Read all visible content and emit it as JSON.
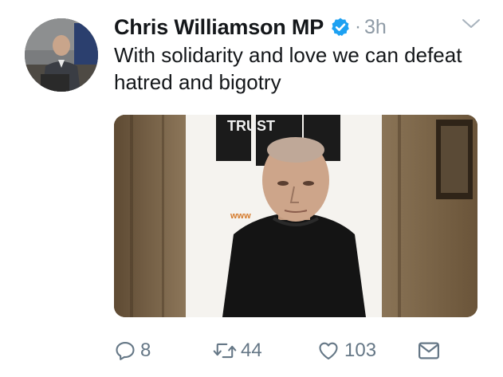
{
  "tweet": {
    "author_name": "Chris Williamson MP",
    "separator": "·",
    "time": "3h",
    "text": "With solidarity and love we can defeat hatred and bigotry",
    "verified": true
  },
  "media": {
    "banner_text": "TRUST",
    "banner_url_text": "www"
  },
  "actions": {
    "reply_count": "8",
    "retweet_count": "44",
    "like_count": "103"
  },
  "colors": {
    "text": "#14171a",
    "secondary": "#657786",
    "verified_blue": "#1da1f2"
  },
  "icons": [
    "caret-down-icon",
    "verified-badge-icon",
    "reply-icon",
    "retweet-icon",
    "like-icon",
    "direct-message-icon"
  ]
}
